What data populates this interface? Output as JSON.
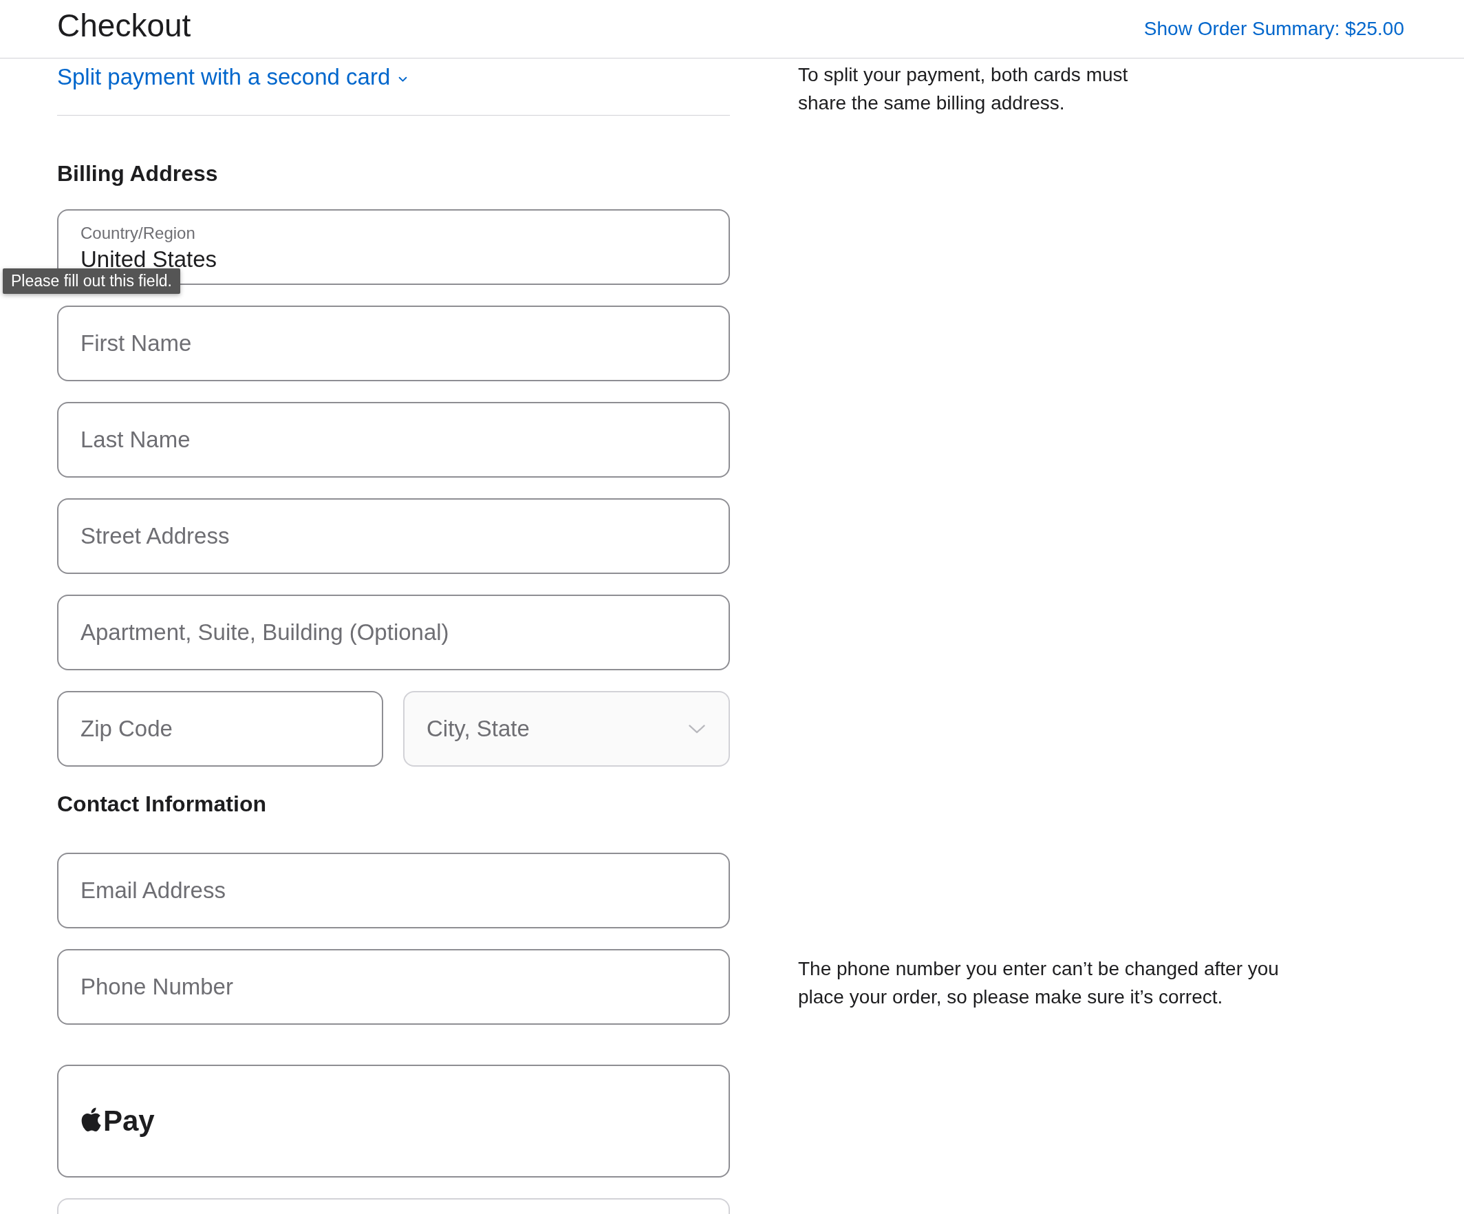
{
  "header": {
    "title": "Checkout",
    "order_summary_link": "Show Order Summary: $25.00"
  },
  "split_payment": {
    "link": "Split payment with a second card",
    "note": "To split your payment, both cards must share the same billing address."
  },
  "billing_address": {
    "heading": "Billing Address",
    "country": {
      "label": "Country/Region",
      "value": "United States"
    },
    "tooltip": "Please fill out this field.",
    "fields": [
      {
        "placeholder": "First Name"
      },
      {
        "placeholder": "Last Name"
      },
      {
        "placeholder": "Street Address"
      },
      {
        "placeholder": "Apartment, Suite, Building (Optional)"
      }
    ],
    "zip_code": {
      "placeholder": "Zip Code"
    },
    "city_state": {
      "placeholder": "City, State",
      "disabled": true
    }
  },
  "contact_information": {
    "heading": "Contact Information",
    "fields": [
      {
        "placeholder": "Email Address"
      },
      {
        "placeholder": "Phone Number"
      }
    ],
    "phone_note": "The phone number you enter can’t be changed after you place your order, so please make sure it’s correct."
  },
  "payment_options": [
    {
      "kind": "apple_pay",
      "label": "Pay",
      "disabled": false
    },
    {
      "kind": "other",
      "disabled": true
    }
  ]
}
